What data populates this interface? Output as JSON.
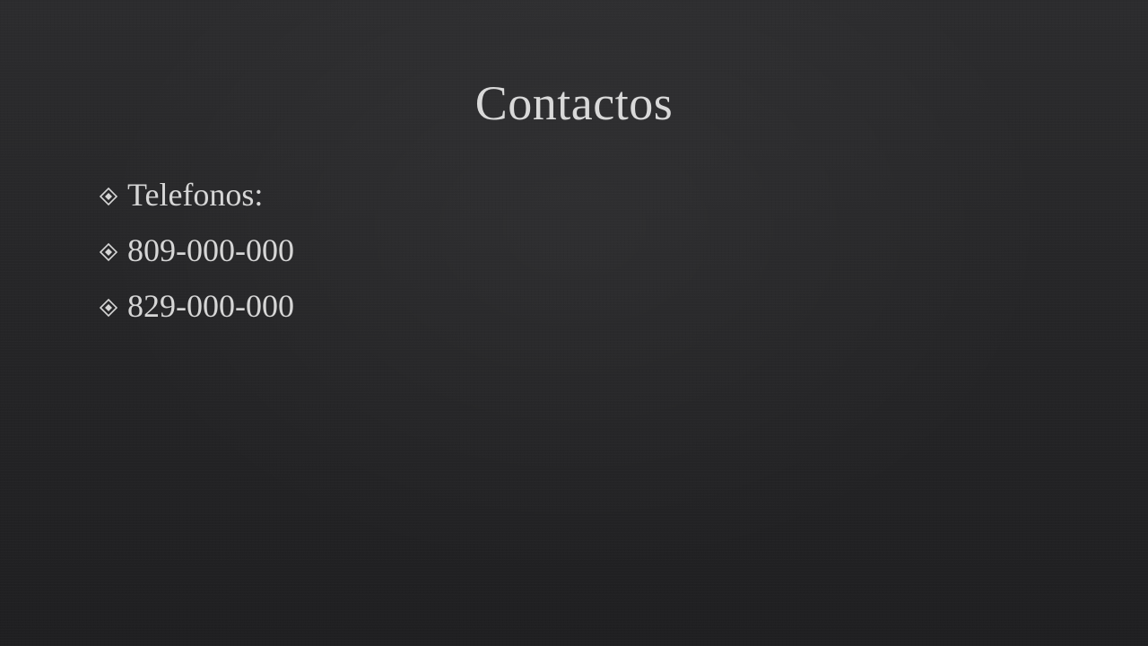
{
  "slide": {
    "title": "Contactos",
    "bullets": [
      {
        "icon": "diamond-bullet-icon",
        "text": "Telefonos:"
      },
      {
        "icon": "diamond-bullet-icon",
        "text": "809-000-000"
      },
      {
        "icon": "diamond-bullet-icon",
        "text": "829-000-000"
      }
    ]
  },
  "colors": {
    "background": "#252527",
    "text": "#d6d6d6"
  }
}
